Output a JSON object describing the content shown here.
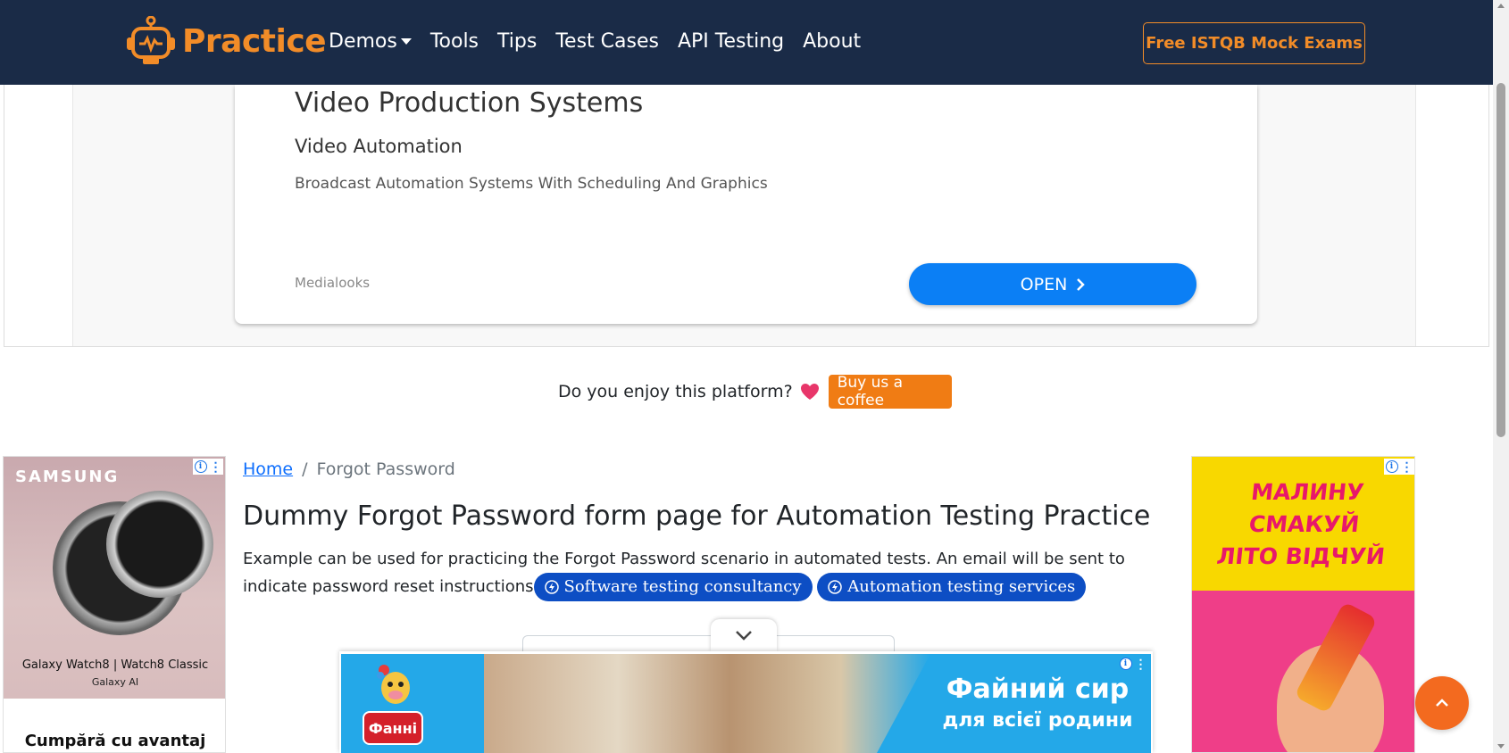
{
  "navbar": {
    "brand": "Practice",
    "links": [
      "Demos",
      "Tools",
      "Tips",
      "Test Cases",
      "API Testing",
      "About"
    ],
    "cta": "Free ISTQB Mock Exams"
  },
  "top_ad": {
    "title": "Video Production Systems",
    "subtitle": "Video Automation",
    "description": "Broadcast Automation Systems With Scheduling And Graphics",
    "advertiser": "Medialooks",
    "button": "OPEN"
  },
  "coffee": {
    "text": "Do you enjoy this platform?",
    "button": "Buy us a coffee"
  },
  "left_ad": {
    "brand": "SAMSUNG",
    "line1": "Galaxy Watch8 | Watch8 Classic",
    "line2": "Galaxy AI",
    "cta": "Cumpără cu avantaj"
  },
  "right_ad": {
    "headline_1": "МАЛИНУ СМАКУЙ",
    "headline_2": "ЛІТО ВІДЧУЙ"
  },
  "breadcrumb": {
    "home": "Home",
    "separator": "/",
    "current": "Forgot Password"
  },
  "main": {
    "heading": "Dummy Forgot Password form page for Automation Testing Practice",
    "description": "Example can be used for practicing the Forgot Password scenario in automated tests. An email will be sent to indicate password reset instructions",
    "pills": [
      "Software testing consultancy",
      "Automation testing services"
    ]
  },
  "bottom_ad": {
    "logo": "Фанні",
    "title": "Файний сир",
    "subtitle": "для всієї родини"
  },
  "colors": {
    "navbar_bg": "#1a2b47",
    "accent_orange": "#f28c28",
    "link_blue": "#0d6efd",
    "pill_blue": "#0d4ec4",
    "open_button": "#0b7ff5"
  }
}
